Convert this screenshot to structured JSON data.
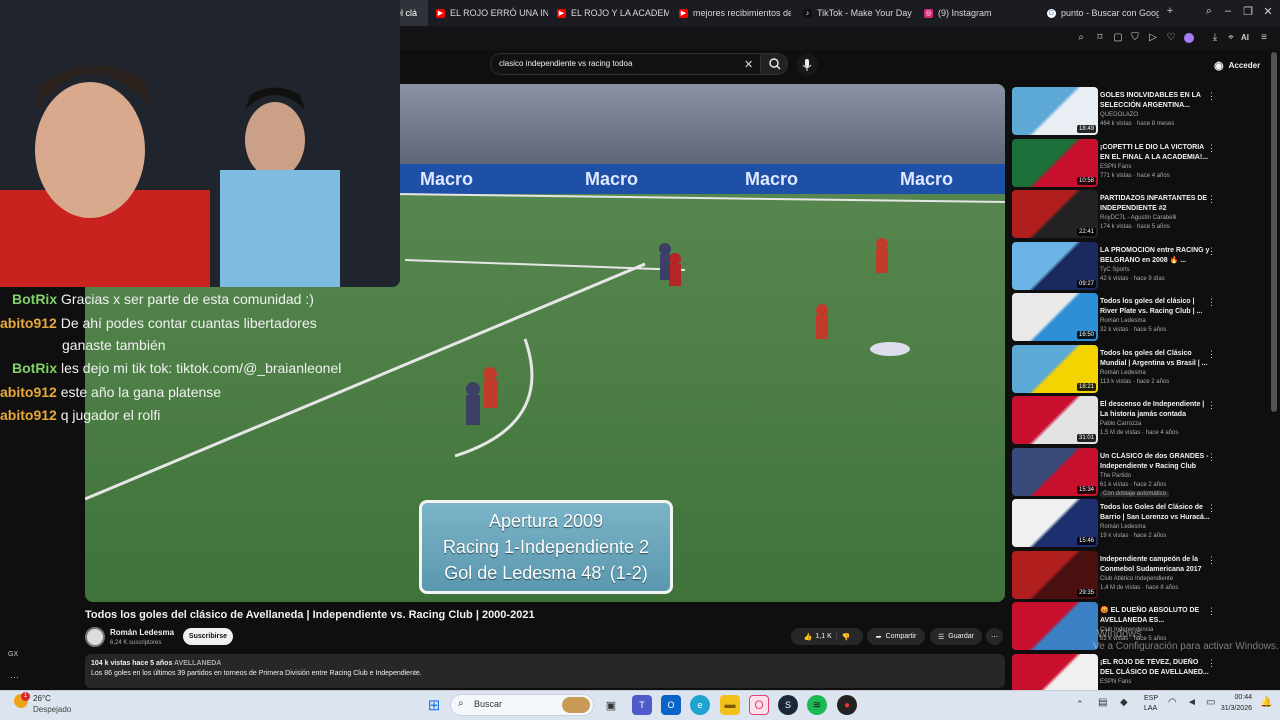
{
  "browser": {
    "tabs": [
      {
        "label": "el clá",
        "icon": "youtube-icon",
        "color": "#a020f0"
      },
      {
        "label": "EL ROJO ERRÓ UNA INC",
        "icon": "youtube-icon",
        "color": "#ff0000"
      },
      {
        "label": "EL ROJO Y LA ACADEMI",
        "icon": "youtube-icon",
        "color": "#ff0000"
      },
      {
        "label": "mejores recibimientos de",
        "icon": "youtube-icon",
        "color": "#ff0000"
      },
      {
        "label": "TikTok - Make Your Day",
        "icon": "tiktok-icon",
        "color": "#111111"
      },
      {
        "label": "(9) Instagram",
        "icon": "instagram-icon",
        "color": "#d62976"
      },
      {
        "label": "punto - Buscar con Goog",
        "icon": "google-icon",
        "color": "#ffffff"
      }
    ],
    "toolbar_ai_label": "AI"
  },
  "youtube": {
    "search_value": "clasico independiente vs racing todoa",
    "signin_label": "Acceder"
  },
  "chat": [
    {
      "user": "BotRix",
      "color": "#7fd36a",
      "msg": "Gracias x ser parte de esta comunidad :)"
    },
    {
      "user": "abito912",
      "color": "#e8a93a",
      "msg": "De ahí podes contar cuantas libertadores"
    },
    {
      "user": "",
      "color": "#e8a93a",
      "msg": "ganaste también"
    },
    {
      "user": "BotRix",
      "color": "#7fd36a",
      "msg": "les dejo mi tik tok: tiktok.com/@_braianleonel"
    },
    {
      "user": "abito912",
      "color": "#e8a93a",
      "msg": "este año la gana platense"
    },
    {
      "user": "abito912",
      "color": "#e8a93a",
      "msg": "q jugador el rolfi"
    }
  ],
  "video": {
    "overlay_line1": "Apertura 2009",
    "overlay_line2": "Racing 1-Independiente 2",
    "overlay_line3": "Gol de Ledesma 48' (1-2)",
    "ad_board": "Macro",
    "title": "Todos los goles del clásico de Avellaneda | Independiente vs. Racing Club | 2000-2021",
    "channel": "Román Ledesma",
    "subscribers": "6,24 K suscriptores",
    "subscribe_label": "Suscribirse",
    "likes": "1,1 K",
    "share_label": "Compartir",
    "save_label": "Guardar",
    "desc_meta": "104 k vistas  hace 5 años",
    "desc_tag": "AVELLANEDA",
    "desc_text": "Los 86 goles en los últimos 39 partidos en torneos de Primera División entre Racing Club e Independiente."
  },
  "recommendations": [
    {
      "title": "GOLES INOLVIDABLES EN LA SELECCIÓN ARGENTINA...",
      "channel": "QUEGOLAZO",
      "meta": "464 k vistas · hace 8 meses",
      "duration": "18:49",
      "c1": "#5da9d6",
      "c2": "#e8eef3"
    },
    {
      "title": "¡COPETTI LE DIO LA VICTORIA EN EL FINAL A LA ACADEMIA!...",
      "channel": "ESPN Fans",
      "meta": "771 k vistas · hace 4 años",
      "duration": "10:58",
      "c1": "#1d6f3a",
      "c2": "#c8102e"
    },
    {
      "title": "PARTIDAZOS INFARTANTES DE INDEPENDIENTE #2",
      "channel": "RoyDC7L - Agustín Carabelli",
      "meta": "174 k vistas · hace 5 años",
      "duration": "22:41",
      "c1": "#b01e1e",
      "c2": "#222222"
    },
    {
      "title": "LA PROMOCIÓN entre RACING y BELGRANO en 2008 🔥 ...",
      "channel": "TyC Sports",
      "meta": "42 k vistas · hace 9 días",
      "duration": "09:27",
      "c1": "#6ab5e6",
      "c2": "#1a2a5e"
    },
    {
      "title": "Todos los goles del clásico | River Plate vs. Racing Club | ...",
      "channel": "Román Ledesma",
      "meta": "32 k vistas · hace 5 años",
      "duration": "16:50",
      "c1": "#e9e9e9",
      "c2": "#2d8fd5"
    },
    {
      "title": "Todos los goles del Clásico Mundial | Argentina vs Brasil | ...",
      "channel": "Román Ledesma",
      "meta": "113 k vistas · hace 2 años",
      "duration": "18:21",
      "c1": "#5da9d6",
      "c2": "#f3d400"
    },
    {
      "title": "El descenso de Independiente | La historia jamás contada",
      "channel": "Pablo Carrozza",
      "meta": "1,5 M de vistas · hace 4 años",
      "duration": "31:01",
      "c1": "#c8102e",
      "c2": "#e2e2e2"
    },
    {
      "title": "Un CLÁSICO de dos GRANDES - Independiente v Racing Club",
      "channel": "The Partido",
      "meta": "61 k vistas · hace 2 años",
      "duration": "15:34",
      "c1": "#3a4a7a",
      "c2": "#c8102e",
      "extra": "Con doblaje automático"
    },
    {
      "title": "Todos los Goles del Clásico de Barrio | San Lorenzo vs Huracá...",
      "channel": "Román Ledesma",
      "meta": "19 k vistas · hace 2 años",
      "duration": "15:46",
      "c1": "#f0f0f0",
      "c2": "#1d2f6e"
    },
    {
      "title": "Independiente campeón de la Conmebol Sudamericana 2017",
      "channel": "Club Atlético Independiente",
      "meta": "1,4 M de vistas · hace 8 años",
      "duration": "29:35",
      "c1": "#b01e1e",
      "c2": "#4a1010"
    },
    {
      "title": "😡 EL DUEÑO ABSOLUTO DE AVELLANEDA ES... ",
      "channel": "Club Independencia",
      "meta": "82 k vistas · hace 5 años",
      "duration": "",
      "c1": "#c8102e",
      "c2": "#3b7fc4"
    },
    {
      "title": "¡EL ROJO DE TÉVEZ, DUEÑO DEL CLÁSICO DE AVELLANED...",
      "channel": "ESPN Fans",
      "meta": "",
      "duration": "",
      "c1": "#c8102e",
      "c2": "#f1f1f1"
    }
  ],
  "watermark": "Ve a Configuración para activar Windows.",
  "watermark_top": "Windows",
  "taskbar": {
    "weather_temp": "26°C",
    "weather_desc": "Despejado",
    "search_placeholder": "Buscar",
    "lang_top": "ESP",
    "lang_bottom": "LAA",
    "time": "00:44",
    "date": "31/3/2026",
    "left_label": "GX"
  }
}
